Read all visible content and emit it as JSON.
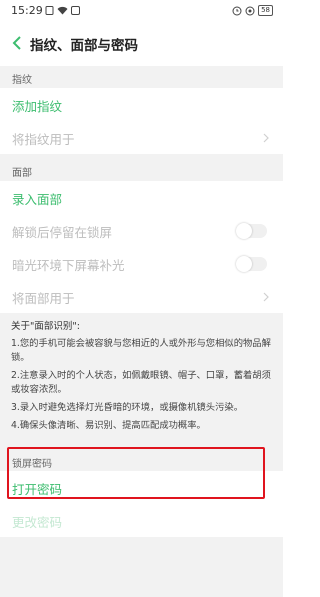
{
  "status_bar": {
    "time": "15:29",
    "left_icons": [
      "sim-icon",
      "wifi-icon",
      "notification-icon"
    ],
    "right_icons": [
      "alarm-icon",
      "headset-icon"
    ],
    "battery": "58"
  },
  "header": {
    "title": "指纹、面部与密码"
  },
  "fingerprint": {
    "section_label": "指纹",
    "add": "添加指纹",
    "use_for": "将指纹用于"
  },
  "face": {
    "section_label": "面部",
    "enroll": "录入面部",
    "stay_on_lock": "解锁后停留在锁屏",
    "stay_on_lock_enabled": false,
    "dim_light": "暗光环境下屏幕补光",
    "dim_light_enabled": false,
    "use_for": "将面部用于"
  },
  "info": {
    "title": "关于\"面部识别\":",
    "p1": "1.您的手机可能会被容貌与您相近的人或外形与您相似的物品解锁。",
    "p2": "2.注意录入时的个人状态，如佩戴眼镜、帽子、口罩，蓄着胡须或妆容浓烈。",
    "p3": "3.录入时避免选择灯光昏暗的环境，或摄像机镜头污染。",
    "p4": "4.确保头像清晰、易识别、提高匹配成功概率。"
  },
  "lock_password": {
    "section_label": "锁屏密码",
    "open": "打开密码",
    "change": "更改密码"
  },
  "colors": {
    "accent": "#3dbd6f",
    "disabled": "#bdbdbd",
    "highlight": "#e0141e"
  }
}
